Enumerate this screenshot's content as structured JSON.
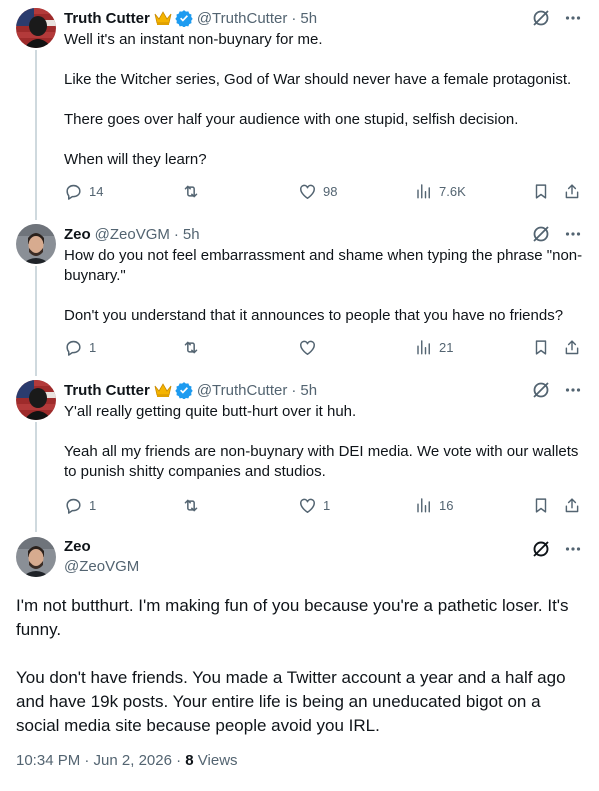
{
  "tweets": [
    {
      "name": "Truth Cutter",
      "handle": "@TruthCutter",
      "time": "5h",
      "paragraphs": [
        "Well it's an instant non-buynary for me.",
        "Like the Witcher series, God of War should never have a female protagonist.",
        "There goes over half your audience with one stupid, selfish decision.",
        "When will they learn?"
      ],
      "replies": "14",
      "retweets": "",
      "likes": "98",
      "views": "7.6K"
    },
    {
      "name": "Zeo",
      "handle": "@ZeoVGM",
      "time": "5h",
      "paragraphs": [
        "How do you not feel embarrassment and shame when typing the phrase \"non-buynary.\"",
        "Don't you understand that it announces to people that you have no friends?"
      ],
      "replies": "1",
      "retweets": "",
      "likes": "",
      "views": "21"
    },
    {
      "name": "Truth Cutter",
      "handle": "@TruthCutter",
      "time": "5h",
      "paragraphs": [
        "Y'all really getting quite butt-hurt over it huh.",
        "Yeah all my friends are non-buynary with DEI media. We vote with our wallets to punish shitty companies and studios."
      ],
      "replies": "1",
      "retweets": "",
      "likes": "1",
      "views": "16"
    }
  ],
  "main_tweet": {
    "name": "Zeo",
    "handle": "@ZeoVGM",
    "paragraphs": [
      "I'm not butthurt. I'm making fun of you because you're a pathetic loser. It's funny.",
      "You don't have friends. You made a Twitter account a year and a half ago and have 19k posts. Your entire life is being an uneducated bigot on a social media site because people avoid you IRL."
    ],
    "timestamp": "10:34 PM · Jun 2, 2026 · ",
    "views_count": "8",
    "views_label": "Views"
  },
  "separator": "·",
  "colors": {
    "text": "#0f1419",
    "secondary": "#536471",
    "verified": "#1d9bf0",
    "thread_line": "#cfd9de",
    "crown": "#f5b400"
  },
  "icons": [
    "crown-icon",
    "verified-badge-icon",
    "grok-icon",
    "more-icon",
    "reply-icon",
    "retweet-icon",
    "like-icon",
    "views-icon",
    "bookmark-icon",
    "share-icon"
  ]
}
